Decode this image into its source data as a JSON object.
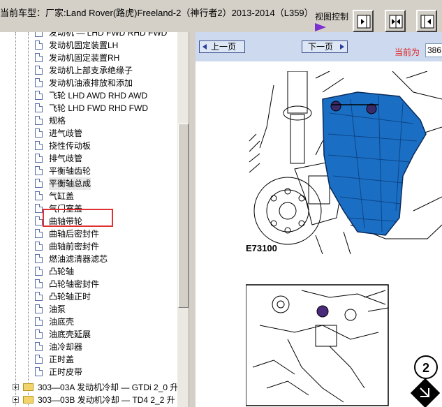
{
  "header": {
    "vehicle_title": "当前车型：厂家:Land Rover(路虎)Freeland-2（神行者2）2013-2014（L359）",
    "view_control_label": "视图控制"
  },
  "tree": {
    "items": [
      "发动机 — LHD FWD RHD FWD",
      "发动机固定装置LH",
      "发动机固定装置RH",
      "发动机上部支承绝缘子",
      "发动机油液排放和添加",
      "飞轮 LHD AWD RHD AWD",
      "飞轮 LHD FWD RHD FWD",
      "规格",
      "进气歧管",
      "挠性传动板",
      "排气歧管",
      "平衡轴齿轮",
      "平衡轴总成",
      "气缸盖",
      "气门室盖",
      "曲轴带轮",
      "曲轴后密封件",
      "曲轴前密封件",
      "燃油滤清器滤芯",
      "凸轮轴",
      "凸轮轴密封件",
      "凸轮轴正时",
      "油泵",
      "油底壳",
      "油底壳延展",
      "油冷却器",
      "正时盖",
      "正时皮带"
    ],
    "selected_index": 12,
    "folders": [
      "303—03A 发动机冷却 — GTDi 2_0 升",
      "303—03B 发动机冷却 — TD4 2_2 升"
    ]
  },
  "nav": {
    "prev_label": "上一页",
    "next_label": "下一页",
    "current_label": "当前为",
    "page_value": "386"
  },
  "figure": {
    "code_1": "E73100",
    "step_number": "2"
  }
}
